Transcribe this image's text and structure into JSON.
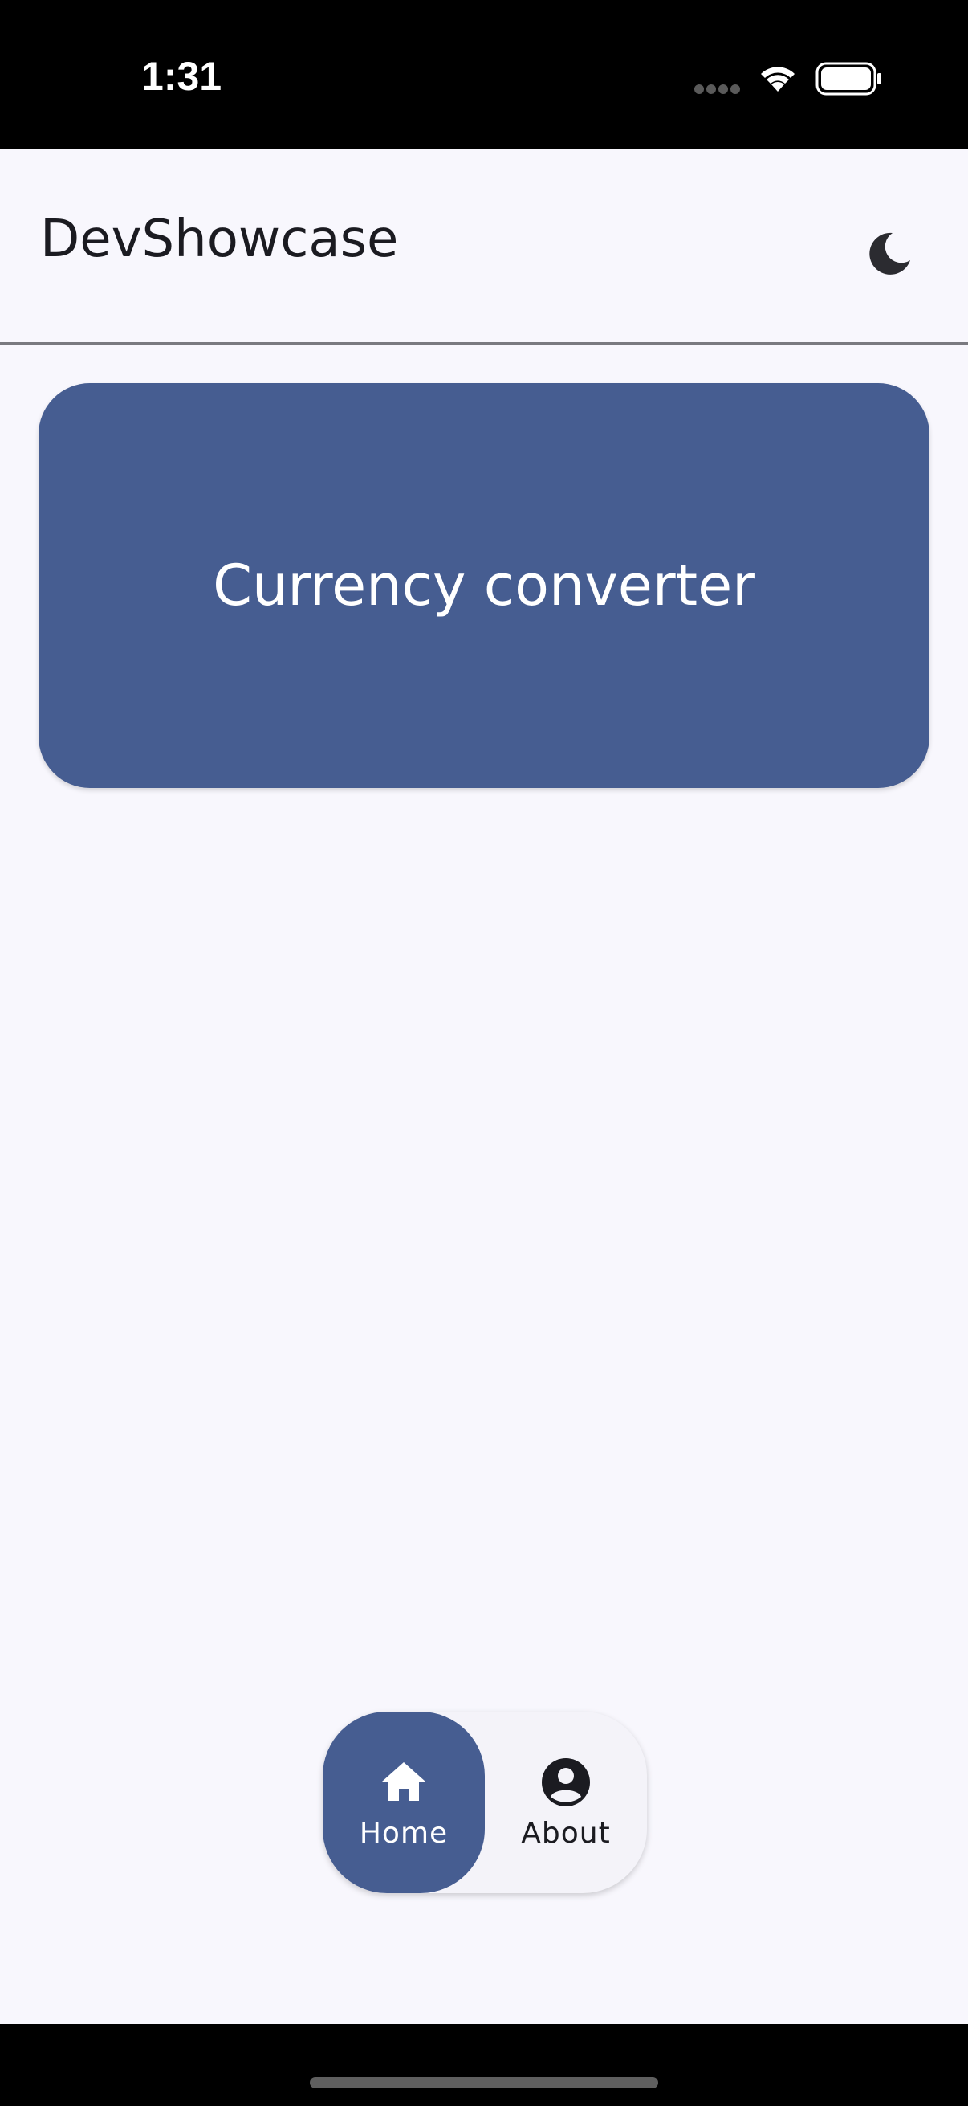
{
  "status_bar": {
    "time": "1:31"
  },
  "app_bar": {
    "title": "DevShowcase",
    "theme_toggle_icon": "moon-icon"
  },
  "cards": [
    {
      "label": "Currency converter"
    }
  ],
  "bottom_nav": {
    "items": [
      {
        "label": "Home",
        "icon": "home-icon",
        "selected": true
      },
      {
        "label": "About",
        "icon": "account-circle-icon",
        "selected": false
      }
    ]
  },
  "colors": {
    "primary": "#465d91",
    "surface": "#f8f7fd",
    "on_surface": "#1b1b21",
    "nav_surface": "#f4f3f9"
  }
}
